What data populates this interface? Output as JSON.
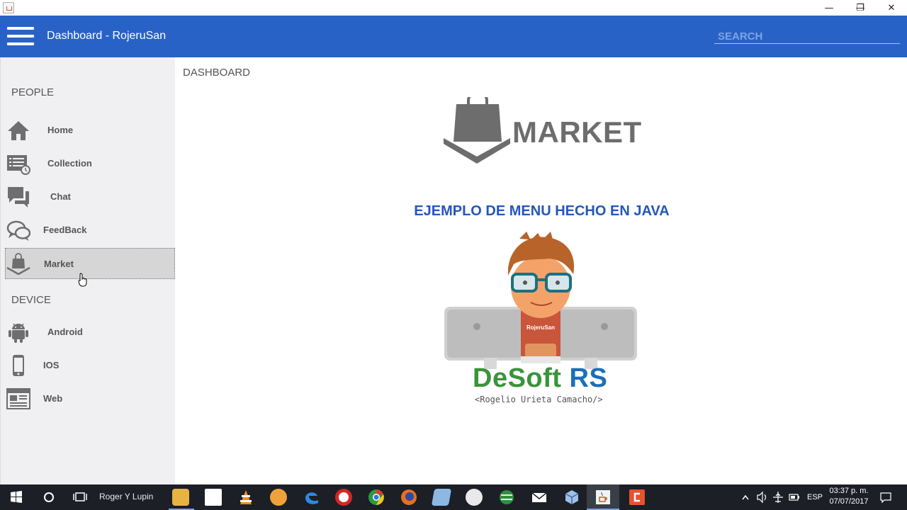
{
  "window": {
    "minimize_glyph": "—",
    "maximize_glyph": "❐",
    "close_glyph": "✕"
  },
  "appbar": {
    "title": "Dashboard - RojeruSan",
    "search_placeholder": "SEARCH"
  },
  "sidebar": {
    "people_title": "PEOPLE",
    "people_items": [
      {
        "label": "Home",
        "icon": "home-icon"
      },
      {
        "label": "Collection",
        "icon": "collection-icon"
      },
      {
        "label": "Chat",
        "icon": "chat-icon"
      },
      {
        "label": "FeedBack",
        "icon": "feedback-icon"
      },
      {
        "label": "Market",
        "icon": "market-icon",
        "active": true
      }
    ],
    "device_title": "DEVICE",
    "device_items": [
      {
        "label": "Android",
        "icon": "android-icon"
      },
      {
        "label": "IOS",
        "icon": "phone-icon"
      },
      {
        "label": "Web",
        "icon": "web-icon"
      }
    ]
  },
  "content": {
    "breadcrumb": "DASHBOARD",
    "market_word": "MARKET",
    "subtitle": "EJEMPLO DE MENU HECHO EN JAVA",
    "avatar_badge": "RojeruSan",
    "brand_green": "DeSoft",
    "brand_blue": "RS",
    "tagline": "<Rogelio Urieta Camacho/>"
  },
  "taskbar": {
    "user": "Roger Y Lupin",
    "language": "ESP",
    "time": "03:37 p. m.",
    "date": "07/07/2017"
  },
  "colors": {
    "appbar": "#2962c6",
    "sidebar": "#f0f0f2",
    "subtitle": "#2457b8",
    "brand_green": "#39943a",
    "brand_blue": "#1b6fb9",
    "taskbar": "#1c1f26"
  }
}
